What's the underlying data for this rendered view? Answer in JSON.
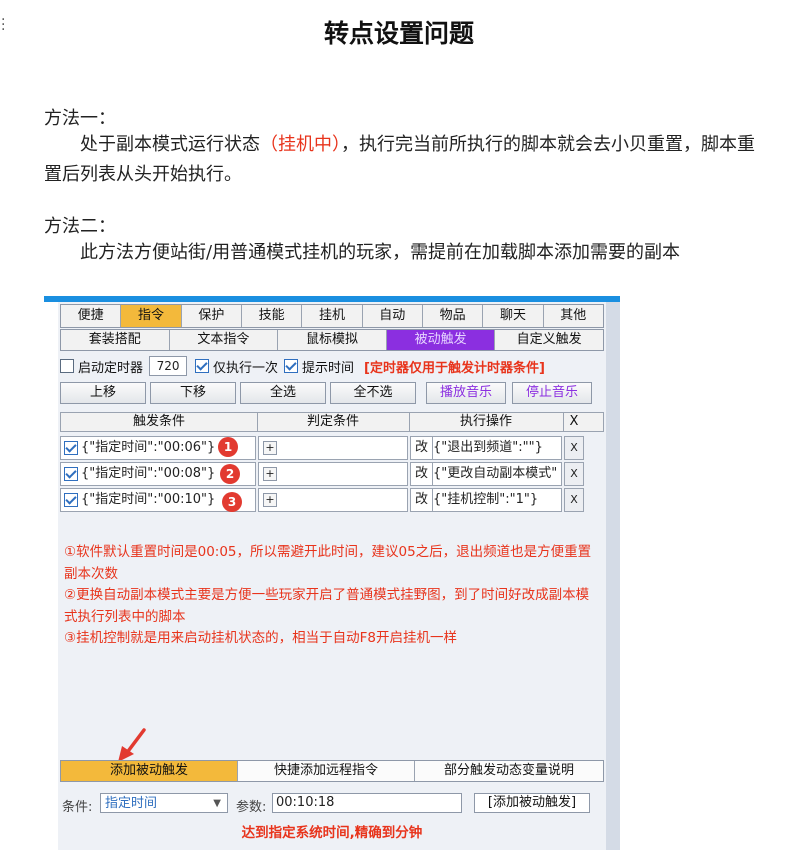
{
  "doc": {
    "title": "转点设置问题",
    "method1_heading": "方法一：",
    "method1_before": "处于副本模式运行状态",
    "method1_highlight": "（挂机中）",
    "method1_after": "，执行完当前所执行的脚本就会去小贝重置，脚本重置后列表从头开始执行。",
    "method2_heading": "方法二：",
    "method2_text": "此方法方便站街/用普通模式挂机的玩家，需提前在加载脚本添加需要的副本"
  },
  "app": {
    "tabs_primary": [
      "便捷",
      "指令",
      "保护",
      "技能",
      "挂机",
      "自动",
      "物品",
      "聊天",
      "其他"
    ],
    "tabs_secondary": [
      "套装搭配",
      "文本指令",
      "鼠标模拟",
      "被动触发",
      "自定义触发"
    ],
    "options": {
      "timer_label": "启动定时器",
      "timer_value": "720",
      "once_label": "仅执行一次",
      "show_time_label": "提示时间",
      "note": "[定时器仅用于触发计时器条件]"
    },
    "buttons": {
      "up": "上移",
      "down": "下移",
      "select_all": "全选",
      "select_none": "全不选",
      "play_music": "播放音乐",
      "stop_music": "停止音乐"
    },
    "table": {
      "headers": [
        "触发条件",
        "判定条件",
        "执行操作",
        "X"
      ],
      "rows": [
        {
          "trigger": "{\"指定时间\":\"00:06\"}",
          "judge_btn": "+",
          "edit": "改",
          "action": "{\"退出到频道\":\"\"}",
          "x": "X",
          "badge": "1"
        },
        {
          "trigger": "{\"指定时间\":\"00:08\"}",
          "judge_btn": "+",
          "edit": "改",
          "action": "{\"更改自动副本模式\"",
          "x": "X",
          "badge": "2"
        },
        {
          "trigger": "{\"指定时间\":\"00:10\"}",
          "judge_btn": "+",
          "edit": "改",
          "action": "{\"挂机控制\":\"1\"}",
          "x": "X",
          "badge": "3"
        }
      ]
    },
    "notes": [
      "①软件默认重置时间是00:05，所以需避开此时间，建议05之后，退出频道也是方便重置副本次数",
      "②更换自动副本模式主要是方便一些玩家开启了普通模式挂野图，到了时间好改成副本模式执行列表中的脚本",
      "③挂机控制就是用来启动挂机状态的，相当于自动F8开启挂机一样"
    ],
    "bottom_tabs": [
      "添加被动触发",
      "快捷添加远程指令",
      "部分触发动态变量说明"
    ],
    "condition": {
      "label": "条件:",
      "value": "指定时间",
      "param_label": "参数:",
      "param_value": "00:10:18",
      "add_button": "[添加被动触发]"
    },
    "bottom_note": "达到指定系统时间,精确到分钟"
  },
  "colors": {
    "accent_orange": "#f3b93b",
    "accent_purple": "#8b2fe0",
    "note_red": "#e8341c",
    "top_blue": "#1a8fe0"
  }
}
